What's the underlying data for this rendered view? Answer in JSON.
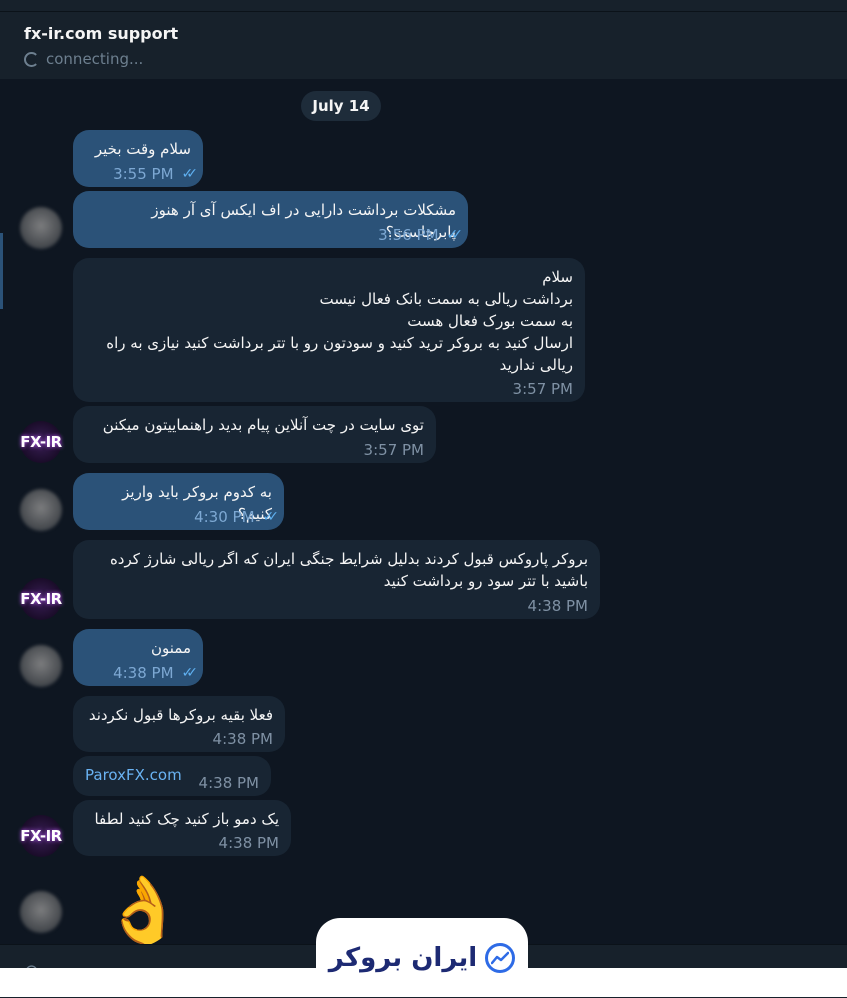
{
  "header": {
    "title": "fx-ir.com support",
    "status": "connecting..."
  },
  "date_label": "July 14",
  "messages": [
    {
      "text": "سلام وقت بخیر",
      "time": "3:55 PM"
    },
    {
      "text": "مشکلات برداشت دارایی در اف ایکس آی آر هنوز پابرجاست؟",
      "time": "3:56 PM"
    },
    {
      "text": "سلام\nبرداشت ریالی به سمت بانک فعال نیست\nبه سمت بورک فعال هست\nارسال کنید به بروکر ترید کنید و سودتون رو با تتر برداشت کنید نیازی به راه ریالی ندارید",
      "time": "3:57 PM"
    },
    {
      "text": "توی سایت در چت آنلاین پیام بدید راهنماییتون میکنن",
      "time": "3:57 PM"
    },
    {
      "text": "به کدوم بروکر باید واریز کنیم؟",
      "time": "4:30 PM"
    },
    {
      "text": "بروکر پاروکس قبول کردند بدلیل شرایط جنگی ایران که اگر ریالی شارژ کرده باشید با تتر سود رو برداشت کنید",
      "time": "4:38 PM"
    },
    {
      "text": "ممنون",
      "time": "4:38 PM"
    },
    {
      "text": "فعلا بقیه بروکرها قبول نکردند",
      "time": "4:38 PM"
    },
    {
      "text": "ParoxFX.com",
      "time": "4:38 PM"
    },
    {
      "text": "یک دمو باز کنید چک کنید لطفا",
      "time": "4:38 PM"
    }
  ],
  "avatars": {
    "support_label": "FX-IR"
  },
  "reaction_emoji": "👌",
  "watermark": {
    "text": "ایران بروکر"
  },
  "colors": {
    "background": "#0e1621",
    "header": "#17212b",
    "outgoing_bubble": "#2b5278",
    "incoming_bubble": "#182533",
    "link": "#6ab3f3",
    "read_checks": "#5fb0f0"
  },
  "icons": {
    "read_receipt": "double-check-icon",
    "attach": "paperclip-icon",
    "status": "spinner-icon"
  }
}
